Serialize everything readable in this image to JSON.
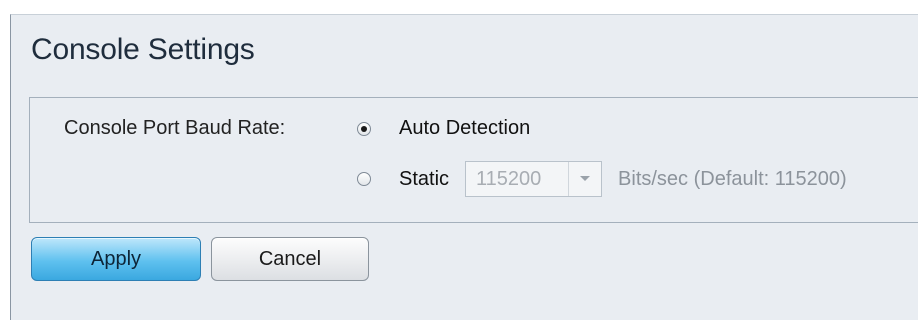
{
  "page": {
    "title": "Console Settings"
  },
  "form": {
    "baud_rate_label": "Console Port Baud Rate:",
    "options": [
      {
        "label": "Auto Detection",
        "selected": true
      },
      {
        "label": "Static",
        "selected": false
      }
    ],
    "static_select": {
      "value": "115200",
      "disabled": true
    },
    "hint": "Bits/sec (Default: 115200)"
  },
  "actions": {
    "apply_label": "Apply",
    "cancel_label": "Cancel"
  },
  "colors": {
    "panel_bg": "#e9edf2",
    "apply_accent": "#5fc1ef",
    "title_text": "#1f2d3d"
  }
}
